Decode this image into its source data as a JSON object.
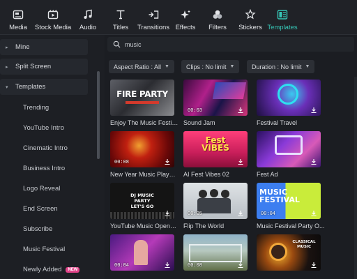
{
  "toolbar": {
    "tabs": [
      {
        "label": "Media",
        "icon": "media-icon"
      },
      {
        "label": "Stock Media",
        "icon": "stock-media-icon"
      },
      {
        "label": "Audio",
        "icon": "music-note-icon"
      },
      {
        "label": "Titles",
        "icon": "title-t-icon"
      },
      {
        "label": "Transitions",
        "icon": "transitions-icon"
      },
      {
        "label": "Effects",
        "icon": "sparkle-icon"
      },
      {
        "label": "Filters",
        "icon": "filters-icon"
      },
      {
        "label": "Stickers",
        "icon": "stickers-icon"
      },
      {
        "label": "Templates",
        "icon": "templates-icon",
        "active": true
      }
    ],
    "accent_color": "#36c6b6"
  },
  "sidebar": {
    "groups": [
      {
        "label": "Mine",
        "expanded": false
      },
      {
        "label": "Split Screen",
        "expanded": false
      },
      {
        "label": "Templates",
        "expanded": true
      }
    ],
    "items": [
      {
        "label": "Trending"
      },
      {
        "label": "YouTube Intro"
      },
      {
        "label": "Cinematic Intro"
      },
      {
        "label": "Business Intro"
      },
      {
        "label": "Logo Reveal"
      },
      {
        "label": "End Screen"
      },
      {
        "label": "Subscribe"
      },
      {
        "label": "Music Festival"
      },
      {
        "label": "Newly Added",
        "badge": "NEW"
      }
    ]
  },
  "search": {
    "value": "music",
    "placeholder": "Search"
  },
  "filters": [
    {
      "label": "Aspect Ratio : All"
    },
    {
      "label": "Clips : No limit"
    },
    {
      "label": "Duration : No limit"
    }
  ],
  "templates": [
    {
      "title": "Enjoy The Music Festival",
      "duration": "",
      "caption": "FIRE PARTY"
    },
    {
      "title": "Sound Jam",
      "duration": "00:03",
      "caption": ""
    },
    {
      "title": "Festival Travel",
      "duration": "",
      "caption": ""
    },
    {
      "title": "New Year Music Player...",
      "duration": "00:08",
      "caption": ""
    },
    {
      "title": "AI Fest Vibes 02",
      "duration": "",
      "caption": "Fest VIBES"
    },
    {
      "title": "Fest Ad",
      "duration": "",
      "caption": ""
    },
    {
      "title": "YouTube Music Opene...",
      "duration": "",
      "caption": "DJ MUSIC PARTY LET'S GO"
    },
    {
      "title": "Flip The World",
      "duration": "00:05",
      "caption": ""
    },
    {
      "title": "Music Festival Party O...",
      "duration": "00:04",
      "caption": "MUSIC FESTIVAL"
    },
    {
      "title": "",
      "duration": "00:04",
      "caption": ""
    },
    {
      "title": "",
      "duration": "00:08",
      "caption": ""
    },
    {
      "title": "",
      "duration": "",
      "caption": "CLASSICAL MUSIC"
    }
  ]
}
